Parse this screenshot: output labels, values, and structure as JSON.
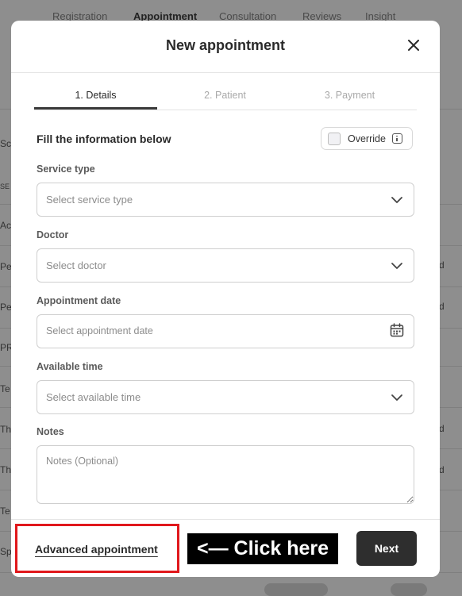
{
  "background": {
    "nav": [
      "Registration",
      "Appointment",
      "Consultation",
      "Reviews",
      "Insight"
    ],
    "active_nav": "Appointment",
    "row_left_fragments": [
      "Sc",
      "SE",
      "Ac",
      "Pe",
      "Pe",
      "PR",
      "Te",
      "Th",
      "Th",
      "Te",
      "Sp"
    ],
    "row_right_fragments": [
      "d",
      "d",
      "d",
      "d"
    ]
  },
  "modal": {
    "title": "New appointment",
    "close_icon": "close-icon",
    "tabs": [
      {
        "label": "1. Details",
        "active": true
      },
      {
        "label": "2. Patient",
        "active": false
      },
      {
        "label": "3. Payment",
        "active": false
      }
    ],
    "section_title": "Fill the information below",
    "override": {
      "label": "Override",
      "checked": false,
      "info_icon": "info-icon"
    },
    "fields": {
      "service_type": {
        "label": "Service type",
        "placeholder": "Select service type",
        "icon": "chevron-down-icon"
      },
      "doctor": {
        "label": "Doctor",
        "placeholder": "Select doctor",
        "icon": "chevron-down-icon"
      },
      "appointment_date": {
        "label": "Appointment date",
        "placeholder": "Select appointment date",
        "icon": "calendar-icon"
      },
      "available_time": {
        "label": "Available time",
        "placeholder": "Select available time",
        "icon": "chevron-down-icon"
      },
      "notes": {
        "label": "Notes",
        "placeholder": "Notes (Optional)"
      }
    },
    "footer": {
      "advanced_link": "Advanced appointment",
      "next_button": "Next"
    }
  },
  "annotation": {
    "label": "<— Click here",
    "highlight_color": "#e0181c"
  },
  "colors": {
    "primary_button": "#2e2e2e",
    "highlight": "#e0181c"
  }
}
